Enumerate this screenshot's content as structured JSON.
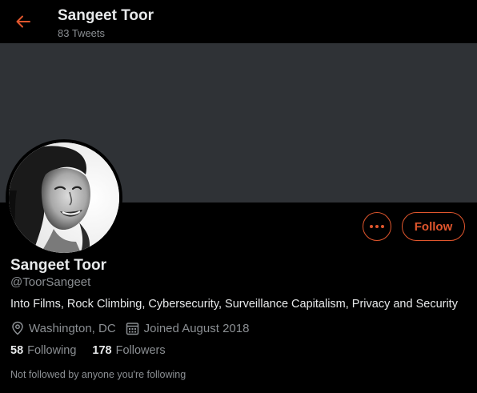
{
  "header": {
    "title": "Sangeet Toor",
    "tweet_count": "83 Tweets"
  },
  "profile": {
    "display_name": "Sangeet Toor",
    "handle": "@ToorSangeet",
    "bio": "Into Films, Rock Climbing, Cybersecurity, Surveillance Capitalism, Privacy and Security",
    "location": "Washington, DC",
    "joined": "Joined August 2018",
    "following_count": "58",
    "following_label": "Following",
    "followers_count": "178",
    "followers_label": "Followers",
    "not_followed_note": "Not followed by anyone you're following"
  },
  "actions": {
    "follow_label": "Follow"
  },
  "icons": {
    "back": "arrow-left-icon",
    "more": "more-dots-icon",
    "location": "location-pin-icon",
    "calendar": "calendar-icon"
  },
  "colors": {
    "accent": "#e0562d",
    "background": "#000000",
    "banner": "#2f3236",
    "muted_text": "#8b8f93",
    "primary_text": "#e7e9ea"
  }
}
